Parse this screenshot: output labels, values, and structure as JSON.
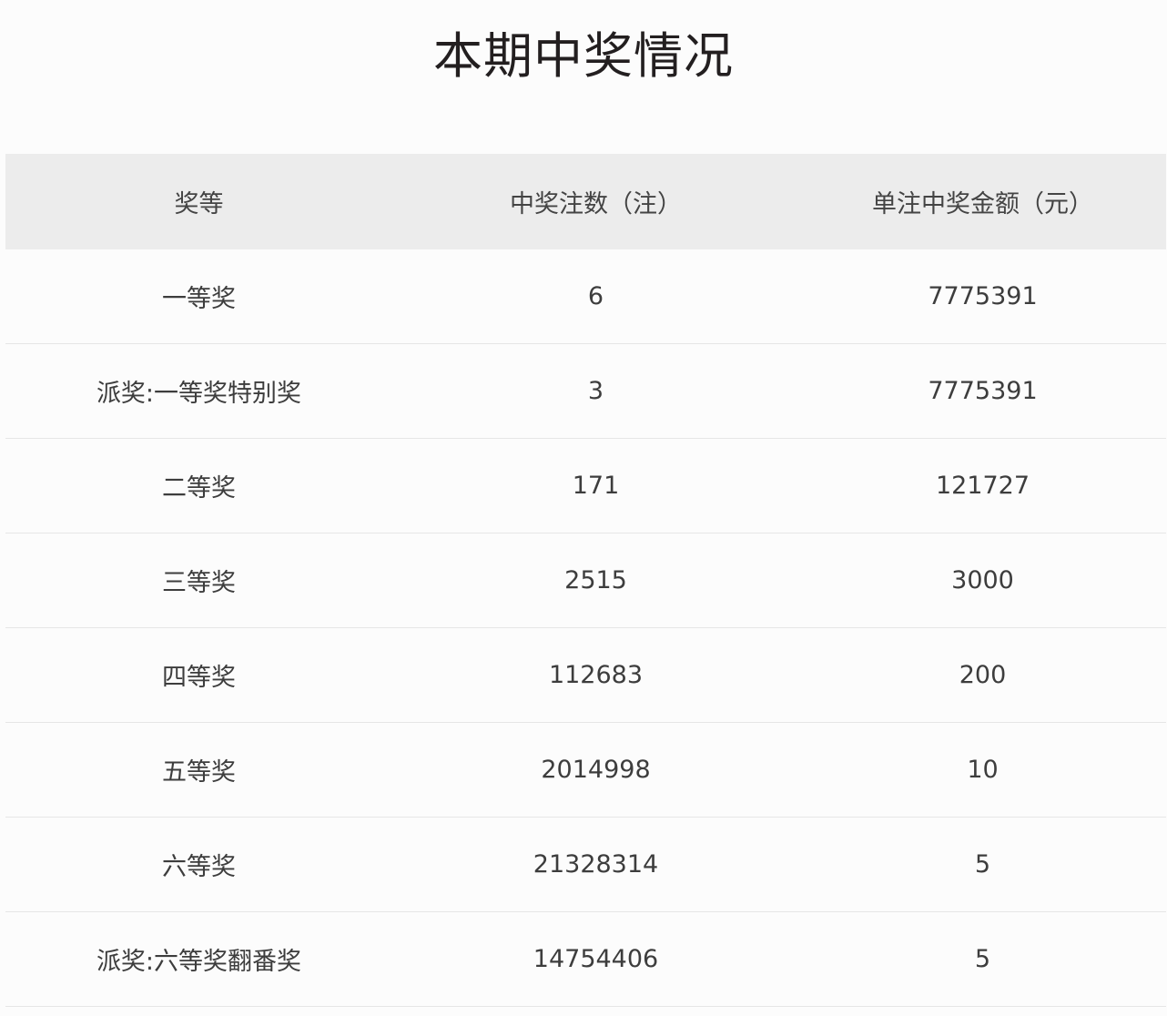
{
  "title": "本期中奖情况",
  "table": {
    "headers": [
      "奖等",
      "中奖注数（注）",
      "单注中奖金额（元）"
    ],
    "rows": [
      [
        "一等奖",
        "6",
        "7775391"
      ],
      [
        "派奖:一等奖特别奖",
        "3",
        "7775391"
      ],
      [
        "二等奖",
        "171",
        "121727"
      ],
      [
        "三等奖",
        "2515",
        "3000"
      ],
      [
        "四等奖",
        "112683",
        "200"
      ],
      [
        "五等奖",
        "2014998",
        "10"
      ],
      [
        "六等奖",
        "21328314",
        "5"
      ],
      [
        "派奖:六等奖翻番奖",
        "14754406",
        "5"
      ]
    ]
  }
}
